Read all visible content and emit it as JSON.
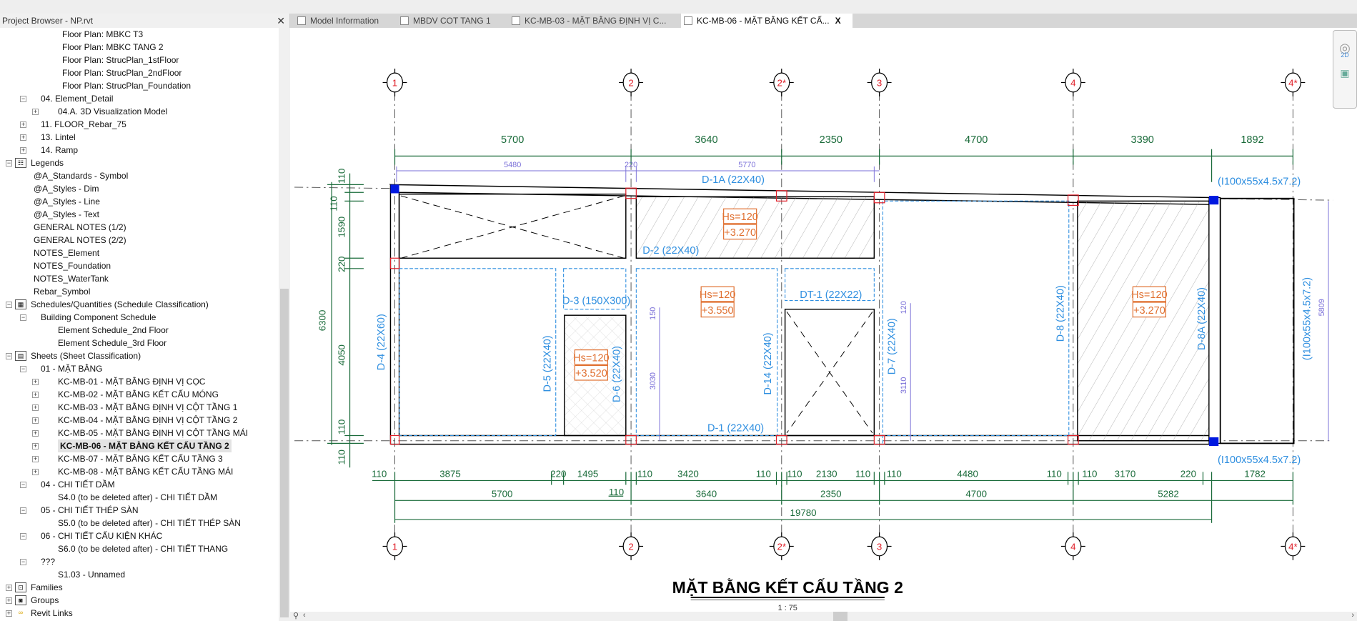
{
  "browser": {
    "title": "Project Browser - NP.rvt",
    "close": "✕",
    "items": [
      {
        "label": "Floor Plan: MBKC T3",
        "lvl": "l3"
      },
      {
        "label": "Floor Plan: MBKC TANG 2",
        "lvl": "l3"
      },
      {
        "label": "Floor Plan: StrucPlan_1stFloor",
        "lvl": "l3"
      },
      {
        "label": "Floor Plan: StrucPlan_2ndFloor",
        "lvl": "l3"
      },
      {
        "label": "Floor Plan: StrucPlan_Foundation",
        "lvl": "l3"
      },
      {
        "label": "04. Element_Detail",
        "lvl": "l1",
        "exp": "−"
      },
      {
        "label": "04.A. 3D Visualization Model",
        "lvl": "l2",
        "exp": "+"
      },
      {
        "label": "11. FLOOR_Rebar_75",
        "lvl": "l1",
        "exp": "+"
      },
      {
        "label": "13. Lintel",
        "lvl": "l1",
        "exp": "+"
      },
      {
        "label": "14. Ramp",
        "lvl": "l1",
        "exp": "+"
      },
      {
        "label": "Legends",
        "lvl": "l0",
        "exp": "−",
        "icon": "legend-icon"
      },
      {
        "label": "@A_Standards - Symbol",
        "lvl": "l1n"
      },
      {
        "label": "@A_Styles - Dim",
        "lvl": "l1n"
      },
      {
        "label": "@A_Styles - Line",
        "lvl": "l1n"
      },
      {
        "label": "@A_Styles - Text",
        "lvl": "l1n"
      },
      {
        "label": "GENERAL NOTES (1/2)",
        "lvl": "l1n"
      },
      {
        "label": "GENERAL NOTES (2/2)",
        "lvl": "l1n"
      },
      {
        "label": "NOTES_Element",
        "lvl": "l1n"
      },
      {
        "label": "NOTES_Foundation",
        "lvl": "l1n"
      },
      {
        "label": "NOTES_WaterTank",
        "lvl": "l1n"
      },
      {
        "label": "Rebar_Symbol",
        "lvl": "l1n"
      },
      {
        "label": "Schedules/Quantities (Schedule Classification)",
        "lvl": "l0",
        "exp": "−",
        "icon": "schedule-icon"
      },
      {
        "label": "Building Component Schedule",
        "lvl": "l1",
        "exp": "−"
      },
      {
        "label": "Element Schedule_2nd Floor",
        "lvl": "l2n"
      },
      {
        "label": "Element Schedule_3rd Floor",
        "lvl": "l2n"
      },
      {
        "label": "Sheets (Sheet Classification)",
        "lvl": "l0",
        "exp": "−",
        "icon": "sheet-icon"
      },
      {
        "label": "01 - MẶT BẰNG",
        "lvl": "l1",
        "exp": "−"
      },
      {
        "label": "KC-MB-01 - MẶT BẰNG ĐỊNH VỊ CỌC",
        "lvl": "l2",
        "exp": "+"
      },
      {
        "label": "KC-MB-02 - MẶT BẰNG KẾT CẤU MÓNG",
        "lvl": "l2",
        "exp": "+"
      },
      {
        "label": "KC-MB-03 - MẶT BẰNG ĐỊNH VỊ CỘT TẦNG 1",
        "lvl": "l2",
        "exp": "+"
      },
      {
        "label": "KC-MB-04 - MẶT BẰNG ĐỊNH VỊ CỘT TẦNG 2",
        "lvl": "l2",
        "exp": "+"
      },
      {
        "label": "KC-MB-05 - MẶT BẰNG ĐỊNH VỊ CỘT TẦNG MÁI",
        "lvl": "l2",
        "exp": "+"
      },
      {
        "label": "KC-MB-06 - MẶT BẰNG KẾT CẤU TẦNG 2",
        "lvl": "l2",
        "exp": "+",
        "selected": true
      },
      {
        "label": "KC-MB-07 - MẶT BẰNG KẾT CẤU TẦNG 3",
        "lvl": "l2",
        "exp": "+"
      },
      {
        "label": "KC-MB-08 - MẶT BẰNG KẾT CẤU TẦNG MÁI",
        "lvl": "l2",
        "exp": "+"
      },
      {
        "label": "04 - CHI TIẾT DẦM",
        "lvl": "l1",
        "exp": "−"
      },
      {
        "label": "S4.0 (to be deleted after) - CHI TIẾT DẦM",
        "lvl": "l2n"
      },
      {
        "label": "05 - CHI TIẾT THÉP SÀN",
        "lvl": "l1",
        "exp": "−"
      },
      {
        "label": "S5.0 (to be deleted after) - CHI TIẾT THÉP SÀN",
        "lvl": "l2n"
      },
      {
        "label": "06 - CHI TIẾT CẤU KIỆN KHÁC",
        "lvl": "l1",
        "exp": "−"
      },
      {
        "label": "S6.0 (to be deleted after) - CHI TIẾT THANG",
        "lvl": "l2n"
      },
      {
        "label": "???",
        "lvl": "l1",
        "exp": "−"
      },
      {
        "label": "S1.03 - Unnamed",
        "lvl": "l2n"
      },
      {
        "label": "Families",
        "lvl": "l0",
        "exp": "+",
        "icon": "families-icon"
      },
      {
        "label": "Groups",
        "lvl": "l0",
        "exp": "+",
        "icon": "groups-icon"
      },
      {
        "label": "Revit Links",
        "lvl": "l0",
        "exp": "+",
        "icon": "revit-links-icon"
      }
    ]
  },
  "tabs": [
    {
      "label": "Model Information",
      "icon": "model-info-icon"
    },
    {
      "label": "MBDV COT TANG 1",
      "icon": "view-icon"
    },
    {
      "label": "KC-MB-03 - MẶT BẰNG ĐỊNH VỊ C...",
      "icon": "sheet-icon"
    },
    {
      "label": "KC-MB-06 - MẶT BẰNG KẾT CẤ...",
      "icon": "sheet-icon",
      "active": true,
      "close": "X"
    }
  ],
  "nav": {
    "label_2d": "2D"
  },
  "drawing": {
    "grids": [
      "1",
      "2",
      "2*",
      "3",
      "4",
      "4*"
    ],
    "dims_top": [
      "5700",
      "3640",
      "2350",
      "4700",
      "3390",
      "1892"
    ],
    "dims_top_inner": [
      "5480",
      "220",
      "5770"
    ],
    "dims_left_total": "6300",
    "dims_left": [
      "110",
      "110",
      "1590",
      "220",
      "4050",
      "110",
      "110"
    ],
    "dims_bottom_detail": [
      "110",
      "3875",
      "220",
      "1495",
      "110",
      "110",
      "3420",
      "110",
      "110",
      "2130",
      "110",
      "110",
      "4480",
      "110",
      "110",
      "3170",
      "220",
      "1782"
    ],
    "dims_bottom_grid": [
      "5700",
      "3640",
      "2350",
      "4700",
      "5282"
    ],
    "dims_bottom_total": "19780",
    "inner_dims": [
      "150",
      "3030",
      "120",
      "3110",
      "5809"
    ],
    "beams": {
      "d1a": "D-1A (22X40)",
      "d2": "D-2 (22X40)",
      "d3": "D-3 (150X300)",
      "d4": "D-4 (22X60)",
      "d5": "D-5 (22X40)",
      "d6": "D-6 (22X40)",
      "d14": "D-14 (22X40)",
      "dt1": "DT-1 (22X22)",
      "d7": "D-7 (22X40)",
      "d8": "D-8 (22X40)",
      "d8a": "D-8A (22X40)",
      "d1": "D-1 (22X40)",
      "steel": "(I100x55x4.5x7.2)"
    },
    "slabs": [
      {
        "hs": "Hs=120",
        "lvl": "+3.270"
      },
      {
        "hs": "Hs=120",
        "lvl": "+3.520"
      },
      {
        "hs": "Hs=120",
        "lvl": "+3.550"
      },
      {
        "hs": "Hs=120",
        "lvl": "+3.270"
      }
    ],
    "title": "MẶT BẰNG KẾT CẤU TẦNG 2",
    "scale": "1 : 75",
    "colors": {
      "dim": "#1a6b3a",
      "beam_label": "#2f8fe0",
      "slab_tag": "#e07030",
      "grid_bubble": "#e0202a",
      "inner_dim": "#7a6fd8",
      "steel_column": "#0018e0"
    }
  }
}
